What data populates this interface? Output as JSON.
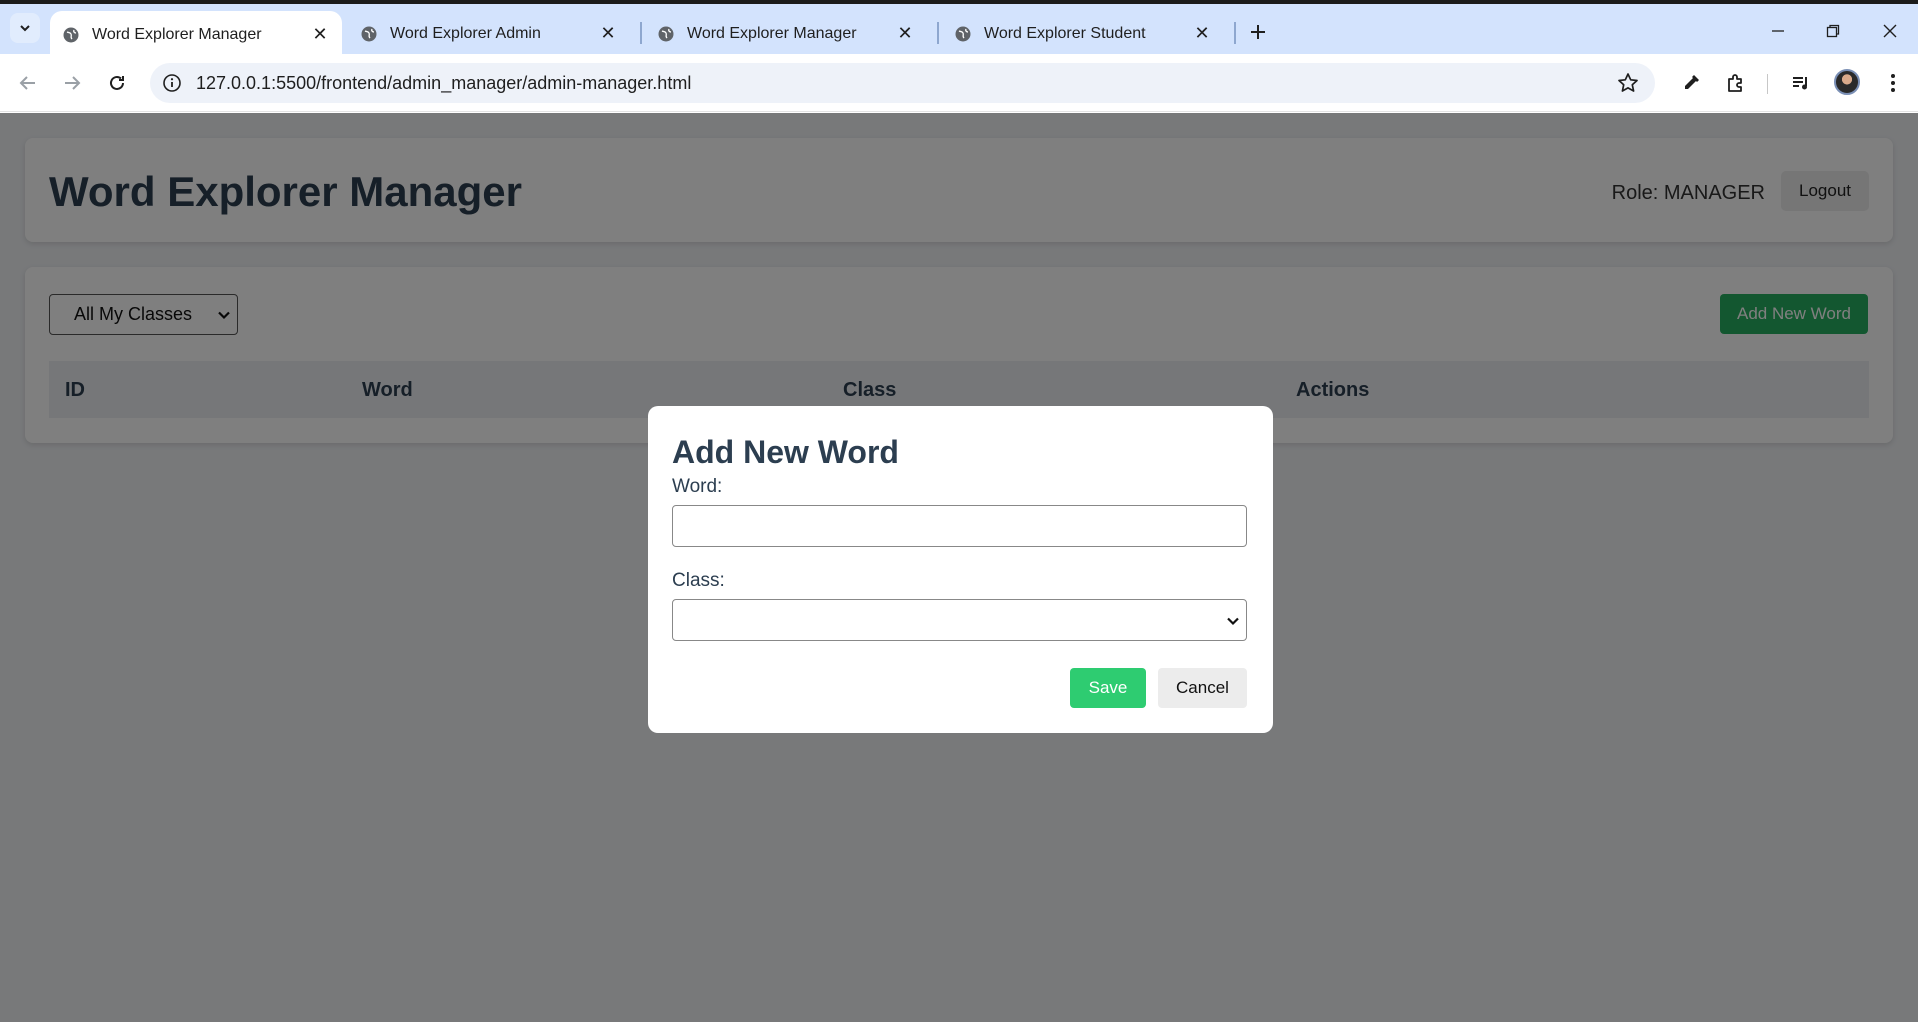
{
  "browser": {
    "tabs": [
      {
        "title": "Word Explorer Manager",
        "active": true
      },
      {
        "title": "Word Explorer Admin",
        "active": false
      },
      {
        "title": "Word Explorer Manager",
        "active": false
      },
      {
        "title": "Word Explorer Student",
        "active": false
      }
    ],
    "url": "127.0.0.1:5500/frontend/admin_manager/admin-manager.html",
    "close_glyph": "✕",
    "new_tab_glyph": "+"
  },
  "header": {
    "title": "Word Explorer Manager",
    "role_text": "Role: MANAGER",
    "logout_label": "Logout"
  },
  "toolbar": {
    "class_filter_value": "All My Classes",
    "add_word_label": "Add New Word"
  },
  "table": {
    "columns": [
      "ID",
      "Word",
      "Class",
      "Actions"
    ]
  },
  "modal": {
    "title": "Add New Word",
    "word_label": "Word:",
    "word_value": "",
    "class_label": "Class:",
    "class_value": "",
    "save_label": "Save",
    "cancel_label": "Cancel"
  },
  "colors": {
    "primary_text": "#2c3e50",
    "add_button": "#27ae60",
    "save_button": "#2ecc71",
    "tabstrip": "#d3e3fd"
  }
}
